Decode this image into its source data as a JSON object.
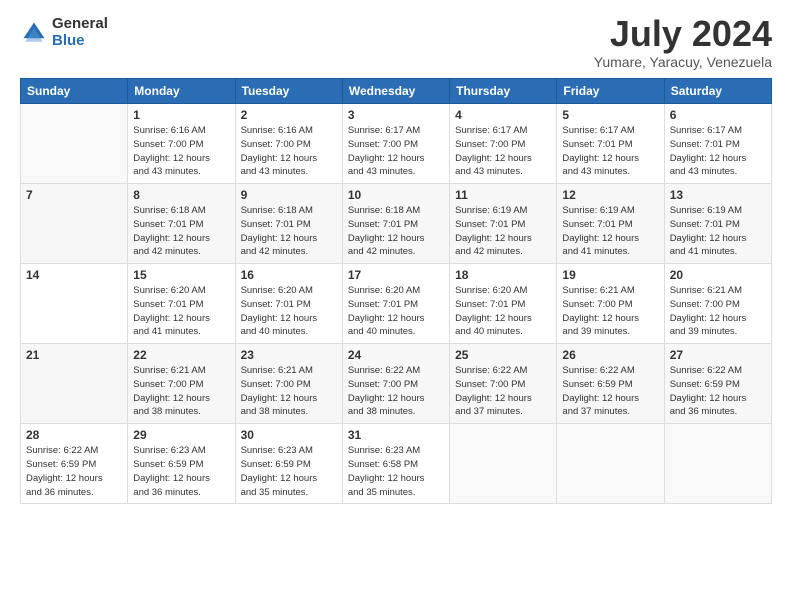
{
  "logo": {
    "general": "General",
    "blue": "Blue"
  },
  "header": {
    "month_year": "July 2024",
    "location": "Yumare, Yaracuy, Venezuela"
  },
  "weekdays": [
    "Sunday",
    "Monday",
    "Tuesday",
    "Wednesday",
    "Thursday",
    "Friday",
    "Saturday"
  ],
  "weeks": [
    [
      {
        "day": "",
        "info": ""
      },
      {
        "day": "1",
        "info": "Sunrise: 6:16 AM\nSunset: 7:00 PM\nDaylight: 12 hours\nand 43 minutes."
      },
      {
        "day": "2",
        "info": "Sunrise: 6:16 AM\nSunset: 7:00 PM\nDaylight: 12 hours\nand 43 minutes."
      },
      {
        "day": "3",
        "info": "Sunrise: 6:17 AM\nSunset: 7:00 PM\nDaylight: 12 hours\nand 43 minutes."
      },
      {
        "day": "4",
        "info": "Sunrise: 6:17 AM\nSunset: 7:00 PM\nDaylight: 12 hours\nand 43 minutes."
      },
      {
        "day": "5",
        "info": "Sunrise: 6:17 AM\nSunset: 7:01 PM\nDaylight: 12 hours\nand 43 minutes."
      },
      {
        "day": "6",
        "info": "Sunrise: 6:17 AM\nSunset: 7:01 PM\nDaylight: 12 hours\nand 43 minutes."
      }
    ],
    [
      {
        "day": "7",
        "info": ""
      },
      {
        "day": "8",
        "info": "Sunrise: 6:18 AM\nSunset: 7:01 PM\nDaylight: 12 hours\nand 42 minutes."
      },
      {
        "day": "9",
        "info": "Sunrise: 6:18 AM\nSunset: 7:01 PM\nDaylight: 12 hours\nand 42 minutes."
      },
      {
        "day": "10",
        "info": "Sunrise: 6:18 AM\nSunset: 7:01 PM\nDaylight: 12 hours\nand 42 minutes."
      },
      {
        "day": "11",
        "info": "Sunrise: 6:19 AM\nSunset: 7:01 PM\nDaylight: 12 hours\nand 42 minutes."
      },
      {
        "day": "12",
        "info": "Sunrise: 6:19 AM\nSunset: 7:01 PM\nDaylight: 12 hours\nand 41 minutes."
      },
      {
        "day": "13",
        "info": "Sunrise: 6:19 AM\nSunset: 7:01 PM\nDaylight: 12 hours\nand 41 minutes."
      }
    ],
    [
      {
        "day": "14",
        "info": ""
      },
      {
        "day": "15",
        "info": "Sunrise: 6:20 AM\nSunset: 7:01 PM\nDaylight: 12 hours\nand 41 minutes."
      },
      {
        "day": "16",
        "info": "Sunrise: 6:20 AM\nSunset: 7:01 PM\nDaylight: 12 hours\nand 40 minutes."
      },
      {
        "day": "17",
        "info": "Sunrise: 6:20 AM\nSunset: 7:01 PM\nDaylight: 12 hours\nand 40 minutes."
      },
      {
        "day": "18",
        "info": "Sunrise: 6:20 AM\nSunset: 7:01 PM\nDaylight: 12 hours\nand 40 minutes."
      },
      {
        "day": "19",
        "info": "Sunrise: 6:21 AM\nSunset: 7:00 PM\nDaylight: 12 hours\nand 39 minutes."
      },
      {
        "day": "20",
        "info": "Sunrise: 6:21 AM\nSunset: 7:00 PM\nDaylight: 12 hours\nand 39 minutes."
      }
    ],
    [
      {
        "day": "21",
        "info": ""
      },
      {
        "day": "22",
        "info": "Sunrise: 6:21 AM\nSunset: 7:00 PM\nDaylight: 12 hours\nand 38 minutes."
      },
      {
        "day": "23",
        "info": "Sunrise: 6:21 AM\nSunset: 7:00 PM\nDaylight: 12 hours\nand 38 minutes."
      },
      {
        "day": "24",
        "info": "Sunrise: 6:22 AM\nSunset: 7:00 PM\nDaylight: 12 hours\nand 38 minutes."
      },
      {
        "day": "25",
        "info": "Sunrise: 6:22 AM\nSunset: 7:00 PM\nDaylight: 12 hours\nand 37 minutes."
      },
      {
        "day": "26",
        "info": "Sunrise: 6:22 AM\nSunset: 6:59 PM\nDaylight: 12 hours\nand 37 minutes."
      },
      {
        "day": "27",
        "info": "Sunrise: 6:22 AM\nSunset: 6:59 PM\nDaylight: 12 hours\nand 36 minutes."
      }
    ],
    [
      {
        "day": "28",
        "info": "Sunrise: 6:22 AM\nSunset: 6:59 PM\nDaylight: 12 hours\nand 36 minutes."
      },
      {
        "day": "29",
        "info": "Sunrise: 6:23 AM\nSunset: 6:59 PM\nDaylight: 12 hours\nand 36 minutes."
      },
      {
        "day": "30",
        "info": "Sunrise: 6:23 AM\nSunset: 6:59 PM\nDaylight: 12 hours\nand 35 minutes."
      },
      {
        "day": "31",
        "info": "Sunrise: 6:23 AM\nSunset: 6:58 PM\nDaylight: 12 hours\nand 35 minutes."
      },
      {
        "day": "",
        "info": ""
      },
      {
        "day": "",
        "info": ""
      },
      {
        "day": "",
        "info": ""
      }
    ]
  ]
}
